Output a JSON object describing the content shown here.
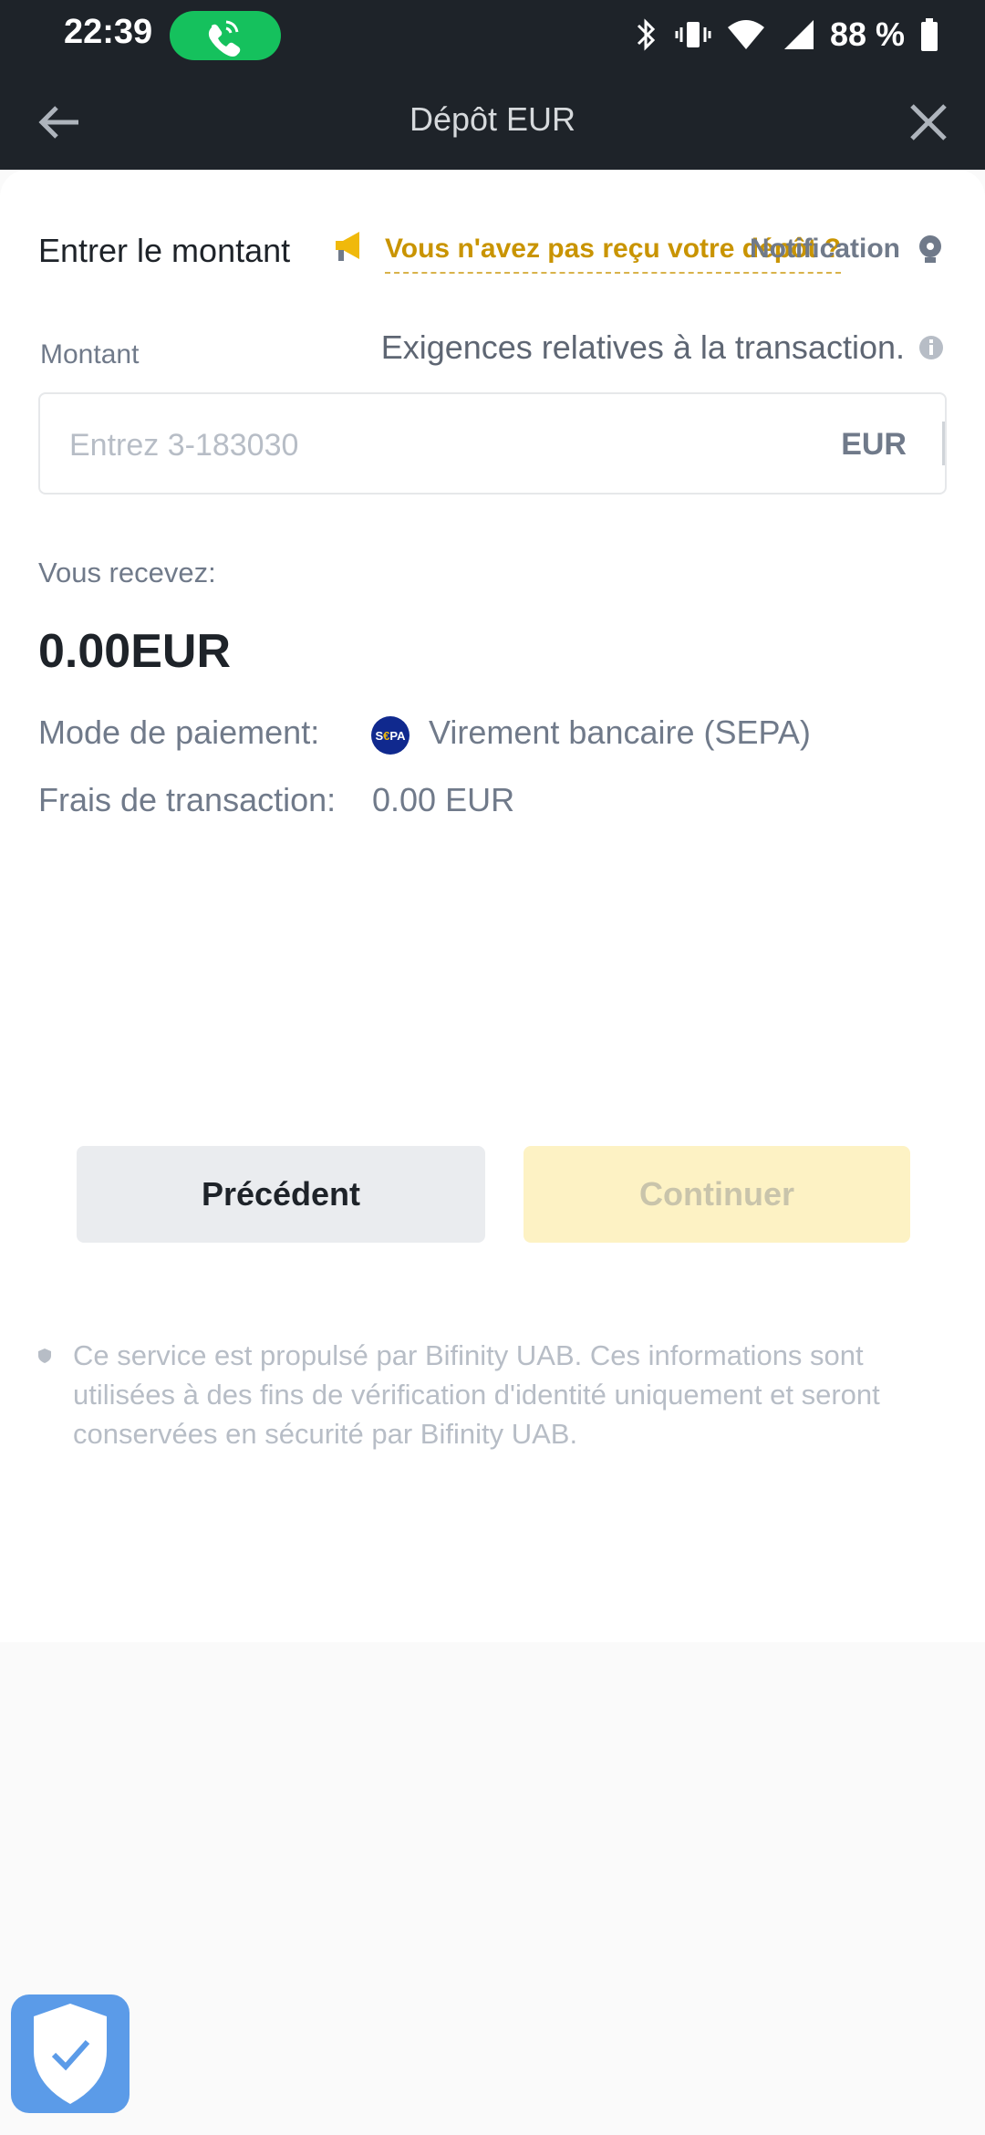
{
  "status_bar": {
    "time": "22:39",
    "battery": "88 %"
  },
  "app_bar": {
    "title": "Dépôt EUR"
  },
  "section": {
    "title": "Entrer le montant",
    "notice_link": "Vous n'avez pas reçu votre dépôt ?",
    "notification_label": "Notification"
  },
  "amount_field": {
    "label": "Montant",
    "requirements": "Exigences relatives à la transaction.",
    "placeholder": "Entrez 3-183030",
    "currency": "EUR"
  },
  "receive": {
    "label": "Vous recevez:",
    "amount": "0.00EUR"
  },
  "details": {
    "payment_label": "Mode de paiement:",
    "payment_value": "Virement bancaire (SEPA)",
    "fee_label": "Frais de transaction:",
    "fee_value": "0.00 EUR"
  },
  "buttons": {
    "previous": "Précédent",
    "continue": "Continuer"
  },
  "footnote": "Ce service est propulsé par Bifinity UAB. Ces informations sont utilisées à des fins de vérification d'identité uniquement et seront conservées en sécurité par Bifinity UAB.",
  "icons": {
    "megaphone": "megaphone-icon",
    "bulb": "bulb-icon",
    "info": "info-icon",
    "sepa": "sepa-icon",
    "shield": "shield-check-icon"
  },
  "colors": {
    "header_bg": "#1e2329",
    "accent": "#f0b90b",
    "link": "#c99400",
    "call_pill": "#15c15d"
  }
}
